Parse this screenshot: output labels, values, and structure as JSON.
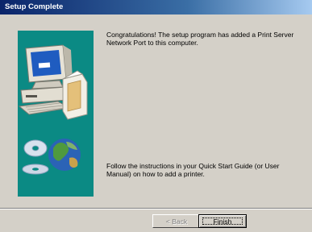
{
  "window": {
    "title": "Setup Complete"
  },
  "illustration": {
    "icon": "computer-with-cds-and-globe-icon",
    "background": "#0b8a84"
  },
  "content": {
    "message_top": "Congratulations! The setup program has added a Print Server Network Port to this computer.",
    "message_bottom": "Follow the instructions in your Quick Start Guide (or User Manual) on how to add a printer."
  },
  "buttons": {
    "back_label": "< Back",
    "finish_label": "Finish"
  },
  "colors": {
    "titlebar": "#0a246a",
    "dialog": "#d4d0c8"
  }
}
